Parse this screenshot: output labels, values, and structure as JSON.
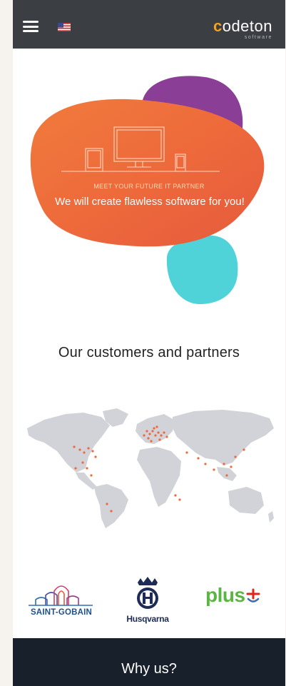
{
  "header": {
    "logo_c": "c",
    "logo_rest": "odeton",
    "logo_sub": "software",
    "icons": [
      "menu-icon",
      "us-flag-icon"
    ]
  },
  "hero": {
    "tagline": "MEET YOUR FUTURE IT PARTNER",
    "title": "We will create flawless software for you!",
    "colors": {
      "orange": "#ee6a3c",
      "purple": "#8a3e96",
      "teal": "#4fd3d8"
    }
  },
  "customers": {
    "title": "Our customers and partners"
  },
  "partners": {
    "saint_gobain": "SAINT-GOBAIN",
    "husqvarna": "Husqvarna",
    "plus": "plus"
  },
  "why": {
    "title": "Why us?"
  }
}
